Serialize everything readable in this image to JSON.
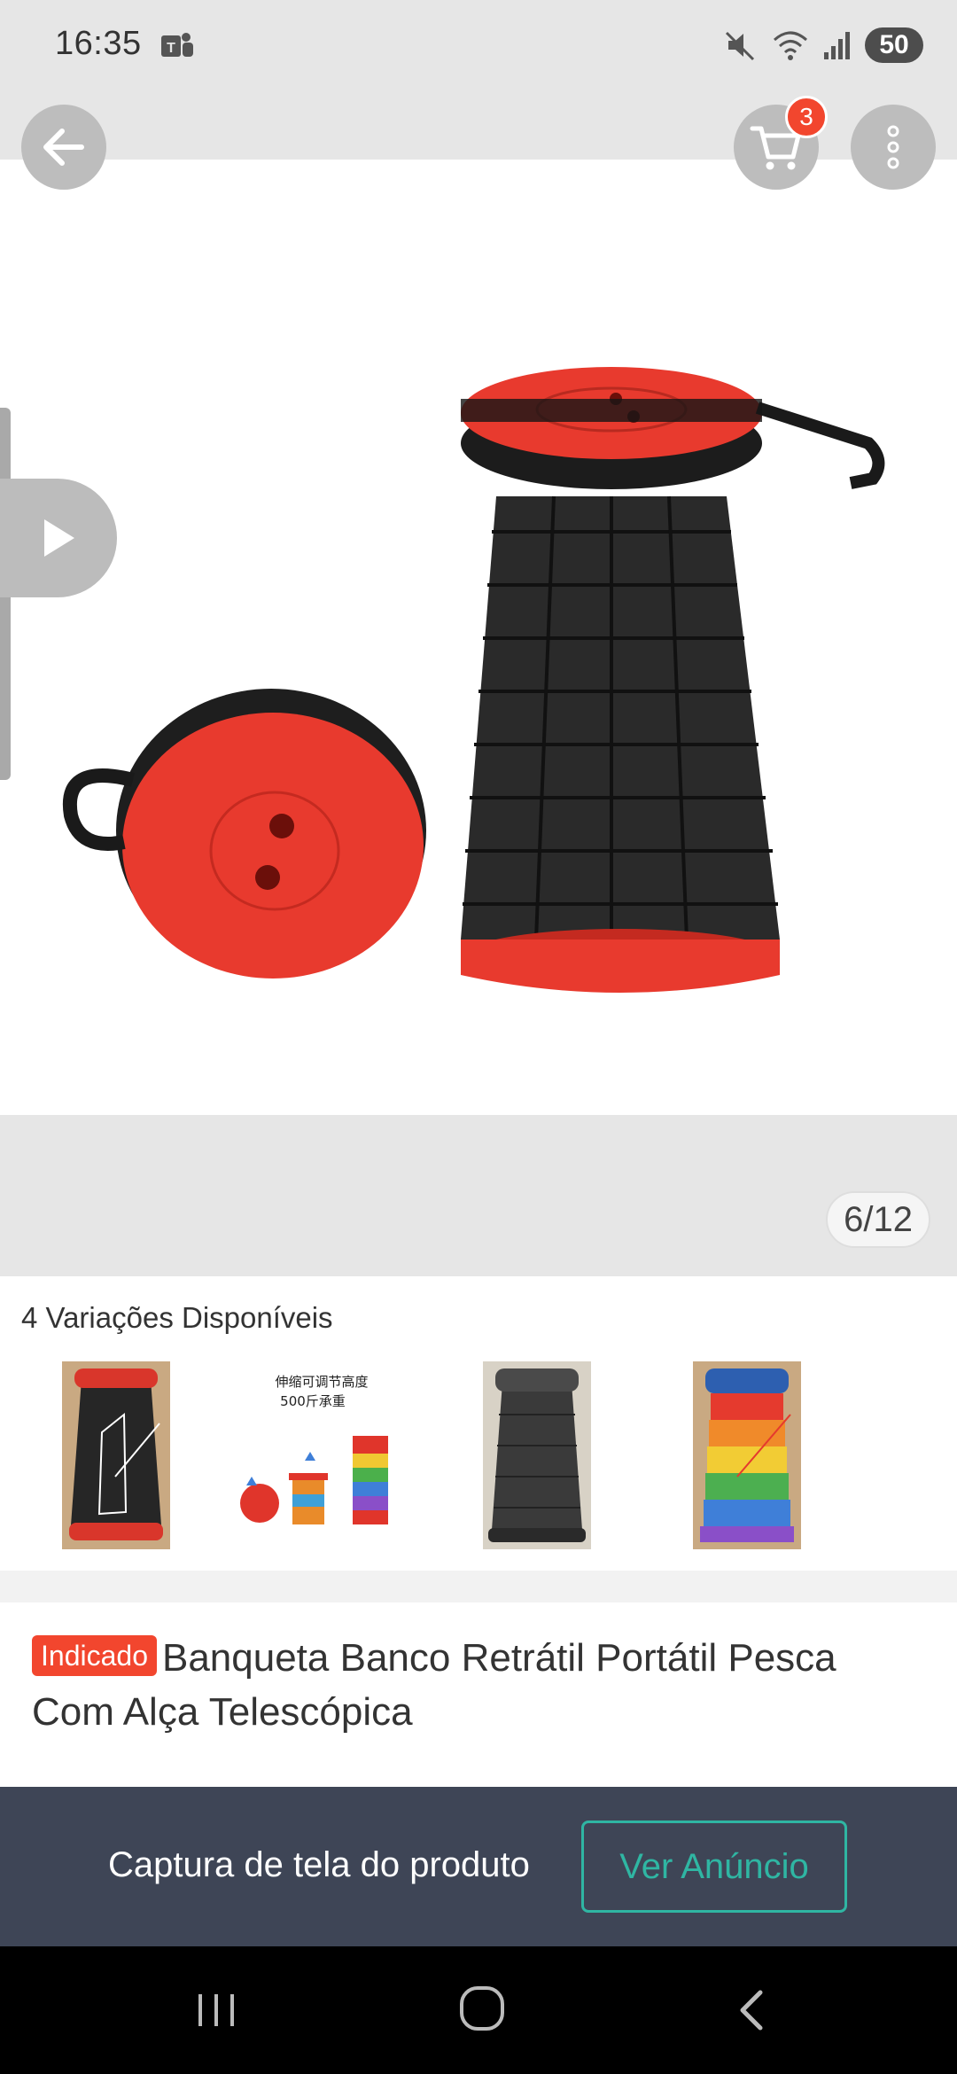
{
  "status_bar": {
    "time": "16:35",
    "battery": "50",
    "icons": [
      "teams-icon",
      "mute-icon",
      "wifi-icon",
      "signal-icon"
    ]
  },
  "header": {
    "cart_count": "3",
    "icons": [
      "back-arrow-icon",
      "cart-icon",
      "more-vert-icon"
    ]
  },
  "gallery": {
    "page_counter": "6/12"
  },
  "variations": {
    "title": "4 Variações Disponíveis",
    "thumb2_caption_line1": "伸缩可调节高度",
    "thumb2_caption_line2": "500斤承重"
  },
  "product": {
    "badge": "Indicado",
    "title": "Banqueta Banco Retrátil Portátil Pesca Com Alça Telescópica"
  },
  "banner": {
    "text": "Captura de tela do produto",
    "button": "Ver Anúncio"
  },
  "colors": {
    "accent_red": "#f2462e",
    "teal": "#2fb6a3",
    "banner_bg": "#3e4556"
  }
}
